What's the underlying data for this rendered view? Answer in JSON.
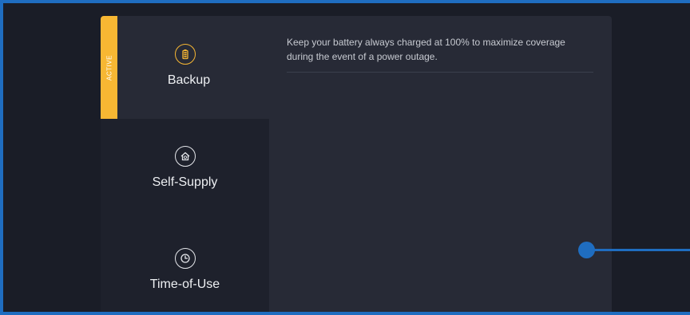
{
  "modes": {
    "active_badge": "ACTIVE",
    "items": [
      {
        "label": "Backup",
        "icon": "battery-icon",
        "active": true
      },
      {
        "label": "Self-Supply",
        "icon": "home-icon",
        "active": false
      },
      {
        "label": "Time-of-Use",
        "icon": "clock-icon",
        "active": false
      }
    ]
  },
  "detail": {
    "description": "Keep your battery always charged at 100% to maximize coverage during the event of a power outage."
  },
  "colors": {
    "accent": "#f7b733",
    "highlight": "#1f6dc0",
    "panel": "#272a36"
  }
}
